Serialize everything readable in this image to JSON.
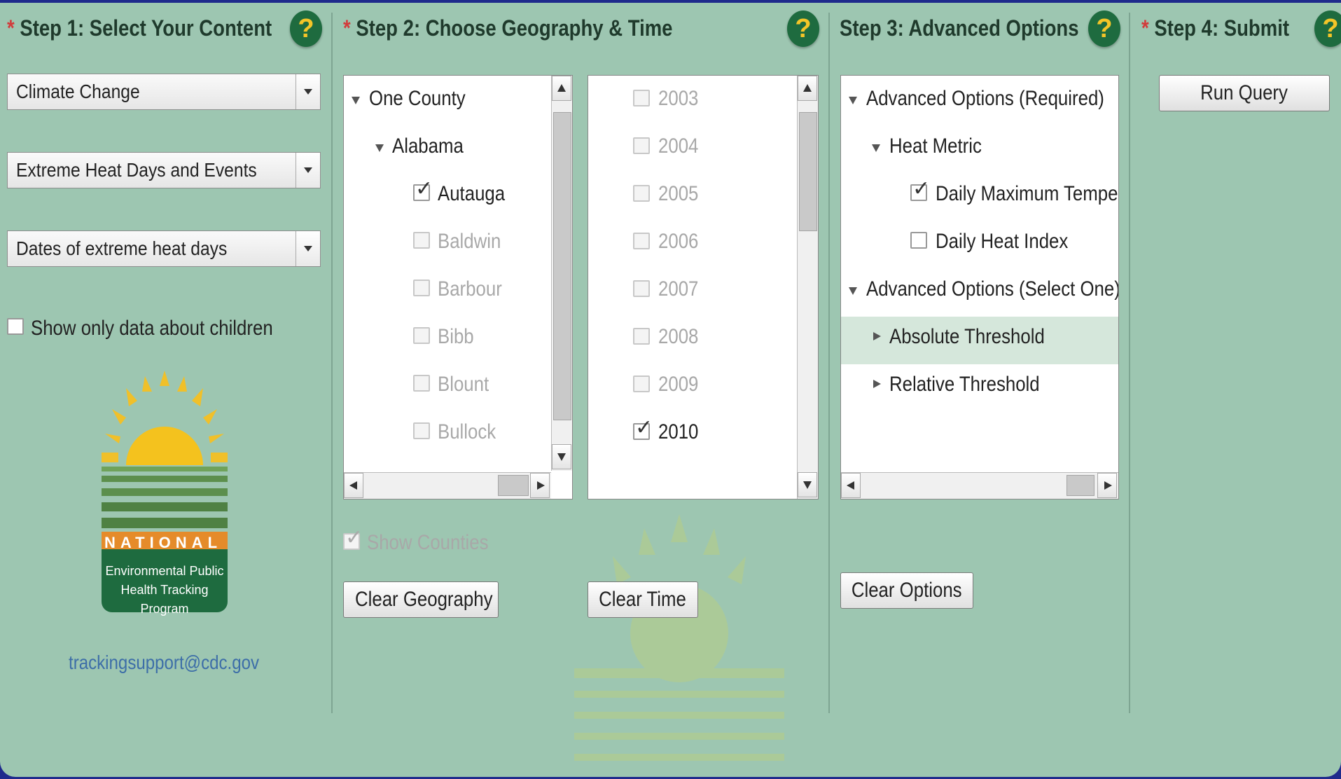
{
  "steps": {
    "step1": {
      "title": "Step 1: Select Your Content",
      "required": "*"
    },
    "step2": {
      "title": "Step 2: Choose Geography & Time",
      "required": "*"
    },
    "step3": {
      "title": "Step 3: Advanced Options"
    },
    "step4": {
      "title": "Step 4: Submit",
      "required": "*"
    },
    "help_label": "?"
  },
  "content": {
    "selects": [
      "Climate Change",
      "Extreme Heat Days and Events",
      "Dates of extreme heat days"
    ],
    "children_only_label": "Show only data about children",
    "children_only_checked": false,
    "logo": {
      "banner": "NATIONAL",
      "line1": "Environmental Public",
      "line2": "Health Tracking",
      "line3": "Program"
    },
    "email": "trackingsupport@cdc.gov"
  },
  "geography": {
    "root": "One County",
    "state": "Alabama",
    "counties": [
      {
        "name": "Autauga",
        "checked": true,
        "enabled": true
      },
      {
        "name": "Baldwin",
        "checked": false,
        "enabled": false
      },
      {
        "name": "Barbour",
        "checked": false,
        "enabled": false
      },
      {
        "name": "Bibb",
        "checked": false,
        "enabled": false
      },
      {
        "name": "Blount",
        "checked": false,
        "enabled": false
      },
      {
        "name": "Bullock",
        "checked": false,
        "enabled": false
      }
    ],
    "show_counties_label": "Show Counties",
    "show_counties_checked": true,
    "clear_label": "Clear Geography"
  },
  "time": {
    "years": [
      {
        "year": "2003",
        "checked": false,
        "enabled": false
      },
      {
        "year": "2004",
        "checked": false,
        "enabled": false
      },
      {
        "year": "2005",
        "checked": false,
        "enabled": false
      },
      {
        "year": "2006",
        "checked": false,
        "enabled": false
      },
      {
        "year": "2007",
        "checked": false,
        "enabled": false
      },
      {
        "year": "2008",
        "checked": false,
        "enabled": false
      },
      {
        "year": "2009",
        "checked": false,
        "enabled": false
      },
      {
        "year": "2010",
        "checked": true,
        "enabled": true
      }
    ],
    "clear_label": "Clear Time"
  },
  "advanced": {
    "required_group": "Advanced Options (Required)",
    "heat_metric": "Heat Metric",
    "metrics": [
      {
        "label": "Daily Maximum Temperature",
        "checked": true
      },
      {
        "label": "Daily Heat Index",
        "checked": false
      }
    ],
    "select_one_group": "Advanced Options (Select One)",
    "thresholds": [
      "Absolute Threshold",
      "Relative Threshold"
    ],
    "clear_label": "Clear Options"
  },
  "submit": {
    "run_label": "Run Query"
  },
  "colors": {
    "accent": "#1e6b3f",
    "background": "#9dc6b1",
    "required_star": "#d23b3b"
  }
}
